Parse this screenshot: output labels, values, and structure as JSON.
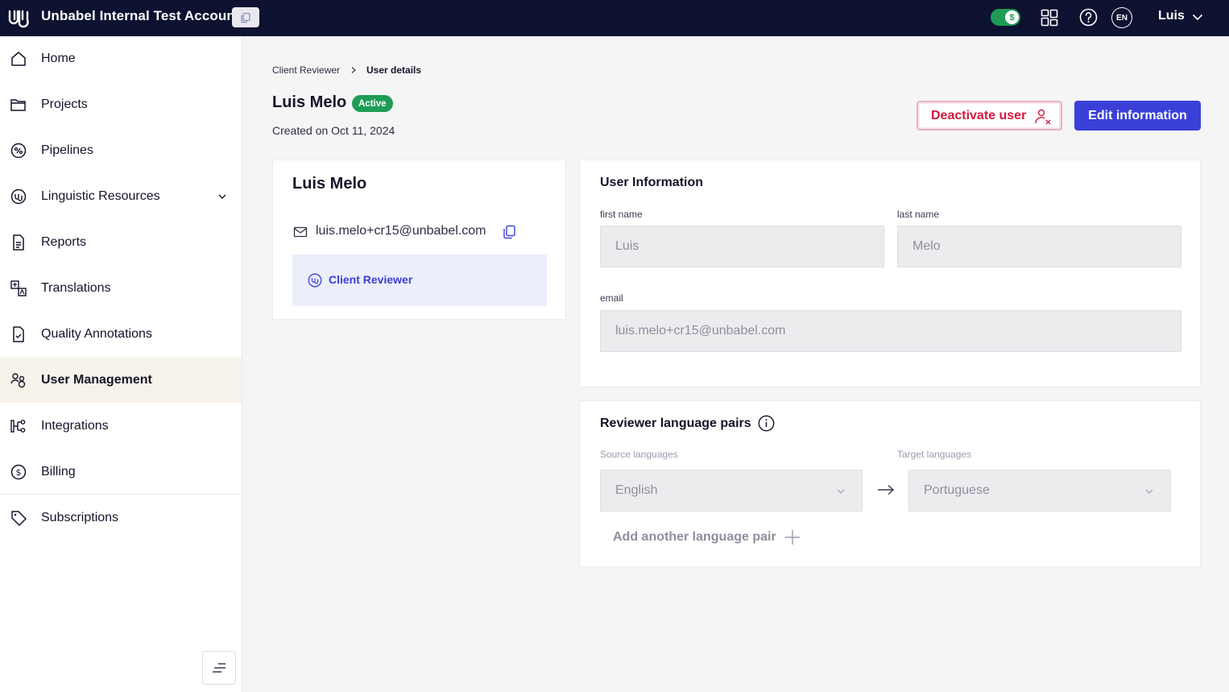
{
  "topbar": {
    "account_name": "Unbabel Internal Test Account",
    "language": "EN",
    "user": "Luis"
  },
  "sidebar": {
    "items": [
      {
        "label": "Home",
        "icon": "home-icon"
      },
      {
        "label": "Projects",
        "icon": "folder-icon"
      },
      {
        "label": "Pipelines",
        "icon": "pipelines-icon"
      },
      {
        "label": "Linguistic Resources",
        "icon": "linguistic-resources-icon"
      },
      {
        "label": "Reports",
        "icon": "report-icon"
      },
      {
        "label": "Translations",
        "icon": "translations-icon"
      },
      {
        "label": "Quality Annotations",
        "icon": "quality-annotations-icon"
      },
      {
        "label": "User Management",
        "icon": "users-icon"
      },
      {
        "label": "Integrations",
        "icon": "integrations-icon"
      },
      {
        "label": "Billing",
        "icon": "billing-icon"
      },
      {
        "label": "Subscriptions",
        "icon": "tag-icon"
      }
    ],
    "active_item": "User Management"
  },
  "breadcrumb": {
    "parent": "Client Reviewer",
    "current": "User details"
  },
  "header": {
    "name": "Luis Melo",
    "status": "Active",
    "created": "Created on Oct 11, 2024",
    "deactivate_label": "Deactivate user",
    "edit_label": "Edit information"
  },
  "profile": {
    "name": "Luis Melo",
    "email": "luis.melo+cr15@unbabel.com",
    "role": "Client Reviewer"
  },
  "user_info": {
    "title": "User Information",
    "first_name_label": "first name",
    "first_name": "Luis",
    "last_name_label": "last name",
    "last_name": "Melo",
    "email_label": "email",
    "email": "luis.melo+cr15@unbabel.com"
  },
  "language_pairs": {
    "title": "Reviewer language pairs",
    "source_label": "Source languages",
    "target_label": "Target languages",
    "source": "English",
    "target": "Portuguese",
    "add_label": "Add another language pair"
  },
  "colors": {
    "topbar_bg": "#0e1231",
    "accent": "#3a3fd8",
    "active_green": "#1e9c55",
    "danger": "#d6183f"
  }
}
